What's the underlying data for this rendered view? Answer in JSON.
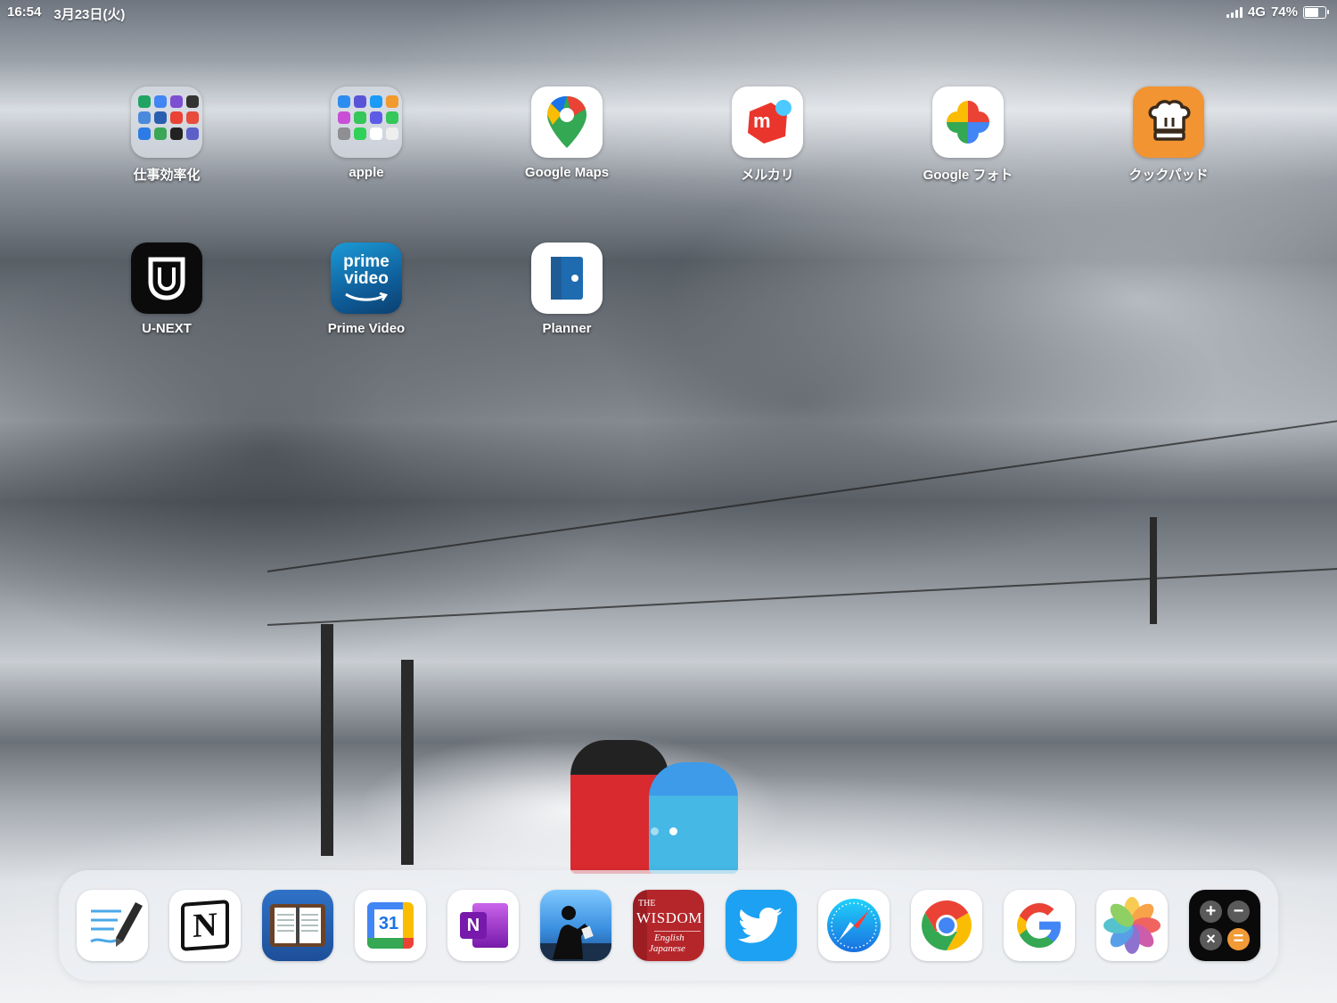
{
  "status_bar": {
    "time": "16:54",
    "date": "3月23日(火)",
    "network": "4G",
    "battery": "74%",
    "battery_level": 0.74
  },
  "home_apps": [
    {
      "label": "仕事効率化",
      "type": "folder",
      "icon": "folder-icon"
    },
    {
      "label": "apple",
      "type": "folder",
      "icon": "folder-icon"
    },
    {
      "label": "Google Maps",
      "type": "app",
      "icon": "google-maps-icon"
    },
    {
      "label": "メルカリ",
      "type": "app",
      "icon": "mercari-icon"
    },
    {
      "label": "Google フォト",
      "type": "app",
      "icon": "google-photos-icon"
    },
    {
      "label": "クックパッド",
      "type": "app",
      "icon": "cookpad-icon"
    },
    {
      "label": "U-NEXT",
      "type": "app",
      "icon": "u-next-icon"
    },
    {
      "label": "Prime Video",
      "type": "app",
      "icon": "prime-video-icon"
    },
    {
      "label": "Planner",
      "type": "app",
      "icon": "planner-icon"
    }
  ],
  "icon_text": {
    "mercari": "m",
    "prime_line1": "prime",
    "prime_line2": "video",
    "calendar_day": "31",
    "onenote": "N",
    "notion": "N",
    "wisdom_the": "THE",
    "wisdom_title": "WISDOM",
    "wisdom_sub1": "English",
    "wisdom_sub2": "Japanese",
    "calc_plus": "+",
    "calc_minus": "−",
    "calc_times": "×",
    "calc_equals": "="
  },
  "page_indicator": {
    "count": 2,
    "current": 2
  },
  "dock_apps": [
    {
      "name": "GoodNotes",
      "icon": "goodnotes-icon"
    },
    {
      "name": "Notion",
      "icon": "notion-icon"
    },
    {
      "name": "Planner Organizer",
      "icon": "organizer-icon"
    },
    {
      "name": "Google Calendar",
      "icon": "google-calendar-icon"
    },
    {
      "name": "OneNote",
      "icon": "onenote-icon"
    },
    {
      "name": "Kindle",
      "icon": "kindle-icon"
    },
    {
      "name": "The Wisdom English Japanese",
      "icon": "wisdom-dictionary-icon"
    },
    {
      "name": "Twitter",
      "icon": "twitter-icon"
    },
    {
      "name": "Safari",
      "icon": "safari-icon"
    },
    {
      "name": "Chrome",
      "icon": "chrome-icon"
    },
    {
      "name": "Google",
      "icon": "google-icon"
    },
    {
      "name": "Photos",
      "icon": "photos-icon"
    },
    {
      "name": "Calculator",
      "icon": "calculator-icon"
    }
  ],
  "colors": {
    "mercari": "#ea352d",
    "cookpad": "#f29432",
    "prime_video": "#0f79af",
    "planner": "#1e6bb0",
    "twitter": "#1da1f2",
    "onenote": "#7719aa",
    "wisdom_red": "#b5262b"
  }
}
